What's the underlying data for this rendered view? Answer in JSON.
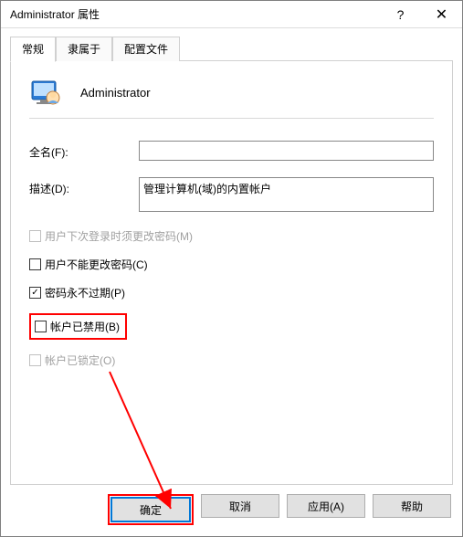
{
  "window": {
    "title": "Administrator 属性",
    "help_glyph": "?",
    "close_glyph": "✕"
  },
  "tabs": {
    "general": "常规",
    "member_of": "隶属于",
    "profile": "配置文件"
  },
  "header": {
    "user_name": "Administrator"
  },
  "fields": {
    "fullname_label": "全名(F):",
    "fullname_value": "",
    "description_label": "描述(D):",
    "description_value": "管理计算机(域)的内置帐户"
  },
  "checks": {
    "must_change": "用户下次登录时须更改密码(M)",
    "cannot_change": "用户不能更改密码(C)",
    "never_expires": "密码永不过期(P)",
    "disabled": "帐户已禁用(B)",
    "locked": "帐户已锁定(O)"
  },
  "buttons": {
    "ok": "确定",
    "cancel": "取消",
    "apply": "应用(A)",
    "help": "帮助"
  }
}
